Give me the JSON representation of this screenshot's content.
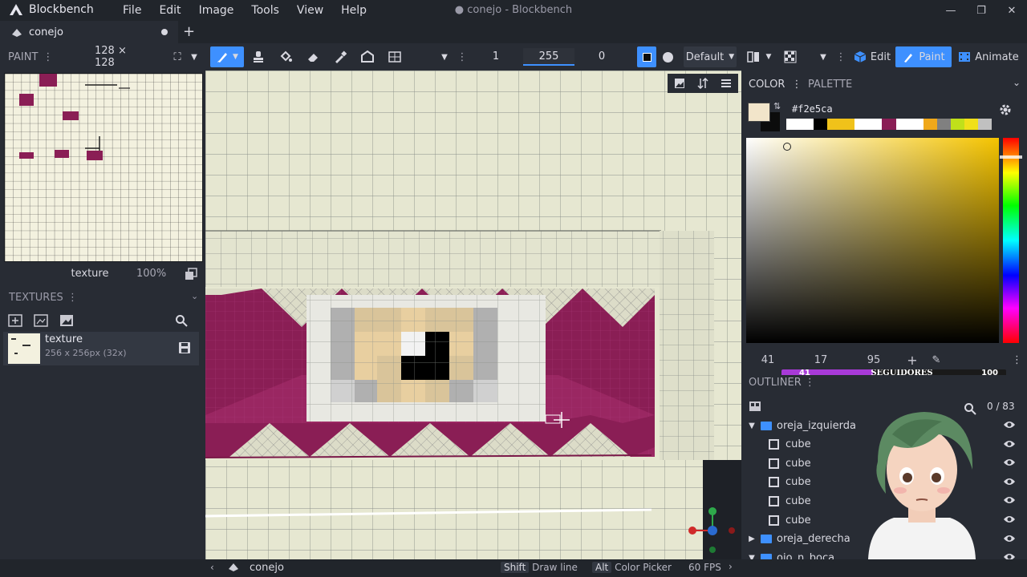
{
  "app": {
    "name": "Blockbench",
    "window_title": "conejo - Blockbench",
    "window_controls": [
      "—",
      "❐",
      "✕"
    ]
  },
  "menu": [
    "File",
    "Edit",
    "Image",
    "Tools",
    "View",
    "Help"
  ],
  "tab": {
    "label": "conejo"
  },
  "toolbar": {
    "mode_label": "PAINT",
    "canvas_size": "128 × 128",
    "brush_size": "1",
    "opacity": "255",
    "softness": "0",
    "blend_mode": "Default",
    "modes": {
      "edit": "Edit",
      "paint": "Paint",
      "animate": "Animate"
    }
  },
  "texture_preview": {
    "name": "texture",
    "zoom": "100%"
  },
  "textures_panel": {
    "title": "TEXTURES",
    "items": [
      {
        "name": "texture",
        "meta": "256 x 256px (32x)"
      }
    ]
  },
  "color_panel": {
    "tabs": [
      "COLOR",
      "PALETTE"
    ],
    "hex": "#f2e5ca",
    "values": [
      "41",
      "17",
      "95"
    ],
    "palette": [
      "#ffffff",
      "#ffffff",
      "#000000",
      "#f0c21a",
      "#f0c21a",
      "#ffffff",
      "#ffffff",
      "#8a1e55",
      "#ffffff",
      "#ffffff",
      "#f0a81a",
      "#808080",
      "#c0e01a",
      "#f0e01a",
      "#c0c0c0"
    ]
  },
  "overlay_bar": {
    "left": "41",
    "center": "SEGUIDORES",
    "right": "100"
  },
  "outliner": {
    "title": "OUTLINER",
    "count": "0 / 83",
    "rows": [
      {
        "type": "group",
        "label": "oreja_izquierda",
        "open": true
      },
      {
        "type": "cube",
        "label": "cube"
      },
      {
        "type": "cube",
        "label": "cube"
      },
      {
        "type": "cube",
        "label": "cube"
      },
      {
        "type": "cube",
        "label": "cube"
      },
      {
        "type": "cube",
        "label": "cube"
      },
      {
        "type": "group",
        "label": "oreja_derecha",
        "open": false
      },
      {
        "type": "group",
        "label": "ojo_n_boca",
        "open": true
      }
    ]
  },
  "statusbar": {
    "project": "conejo",
    "hint1_key": "Shift",
    "hint1_text": "Draw line",
    "hint2_key": "Alt",
    "hint2_text": "Color Picker",
    "fps": "60 FPS"
  },
  "colors": {
    "accent": "#3e90ff",
    "texture_magenta": "#8a1e55",
    "canvas_cream": "#e8e8d2",
    "selected_color": "#f2e5ca"
  }
}
